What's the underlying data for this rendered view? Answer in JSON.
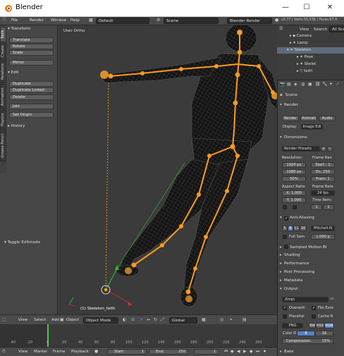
{
  "window": {
    "title": "Blender",
    "minimize": "—",
    "maximize": "☐",
    "close": "✕"
  },
  "infobar": {
    "menus": [
      "File",
      "Render",
      "Window",
      "Help"
    ],
    "layout": "Default",
    "scene": "Scene",
    "engine": "Blender Render",
    "stats": "v2.77 | Verts:55,536 | Faces:97,4"
  },
  "toolshelf": {
    "tabs": [
      "Tools",
      "Create",
      "Relations",
      "Animation",
      "Physics",
      "Grease Pencil"
    ],
    "transform_header": "Transform",
    "transform_buttons": [
      "Translate",
      "Rotate",
      "Scale",
      "Mirror"
    ],
    "edit_header": "Edit",
    "edit_buttons": [
      "Duplicate",
      "Duplicate Linked",
      "Delete",
      "Join",
      "Set Origin"
    ],
    "history_header": "History",
    "toggle_editmode": "Toggle Editmode"
  },
  "viewport": {
    "view_label": "User Ortho",
    "object_label": "(1) Skeleton_faith"
  },
  "viewport_header": {
    "items": [
      "View",
      "Select",
      "Add",
      "Object"
    ],
    "mode": "Object Mode",
    "orientation": "Global"
  },
  "outliner": {
    "tabs": [
      "View",
      "Search",
      "All Sce"
    ],
    "items": [
      "Camera",
      "Lamp",
      "Skeleton",
      "Pose",
      "Skelet",
      "faith"
    ]
  },
  "properties": {
    "scene_label": "Scene",
    "render_section": "Render",
    "render_buttons": [
      "Render",
      "Animati",
      "Audio"
    ],
    "display_label": "Display:",
    "display_value": "Image Edi",
    "dimensions_section": "Dimensions",
    "presets": "Render Presets",
    "resolution_label": "Resolution:",
    "res_x": "1920 px",
    "res_y": "1080 px",
    "res_pct": "50%",
    "frame_range_label": "Frame Ran",
    "start": "Start : 1",
    "end": "En: 250",
    "step": "Fram: 1",
    "aspect_label": "Aspect Ratio",
    "aspect_x": "X: 1.000",
    "aspect_y": "Y: 1.000",
    "frame_rate_label": "Frame Rate",
    "fps": "24 fps",
    "time_remap_label": "Time Rem:",
    "remap_old": "1",
    "remap_new": "1",
    "aa_label": "Anti-Aliasing",
    "aa_samples": [
      "5",
      "8",
      "11",
      "16"
    ],
    "aa_filter": "Mitchell-N",
    "full_sample": "Full Sam",
    "filter_size": "1.000 p",
    "sampled_motion_blur": "Sampled Motion Bl",
    "shading": "Shading",
    "performance": "Performance",
    "post_processing": "Post Processing",
    "metadata": "Metadata",
    "output_section": "Output",
    "output_path": "/tmp\\",
    "overwrite": "Overwrit",
    "file_ext": "File Exte",
    "placeholders": "Placehol",
    "cache_result": "Cache R",
    "format": "PNG",
    "color_modes": [
      "BW",
      "RGB",
      "RGB"
    ],
    "color_depth_label": "Color D",
    "color_depths": [
      "8",
      "16"
    ],
    "compression": "Compression:",
    "compression_value": "15%",
    "bake": "Bake"
  },
  "timeline": {
    "ticks": [
      "-40",
      "-20",
      "0",
      "20",
      "40",
      "60",
      "80",
      "100",
      "120",
      "140",
      "160",
      "180",
      "200",
      "220",
      "240",
      "260"
    ],
    "menu": [
      "View",
      "Marker",
      "Frame",
      "Playback"
    ],
    "start": "Start:",
    "start_value": "1",
    "end": "End:",
    "end_value": "250",
    "current": "1"
  },
  "colors": {
    "bone_orange": "#ff9b20",
    "selection": "#ffb100",
    "axis_x": "#d03030",
    "axis_y": "#30c030"
  }
}
